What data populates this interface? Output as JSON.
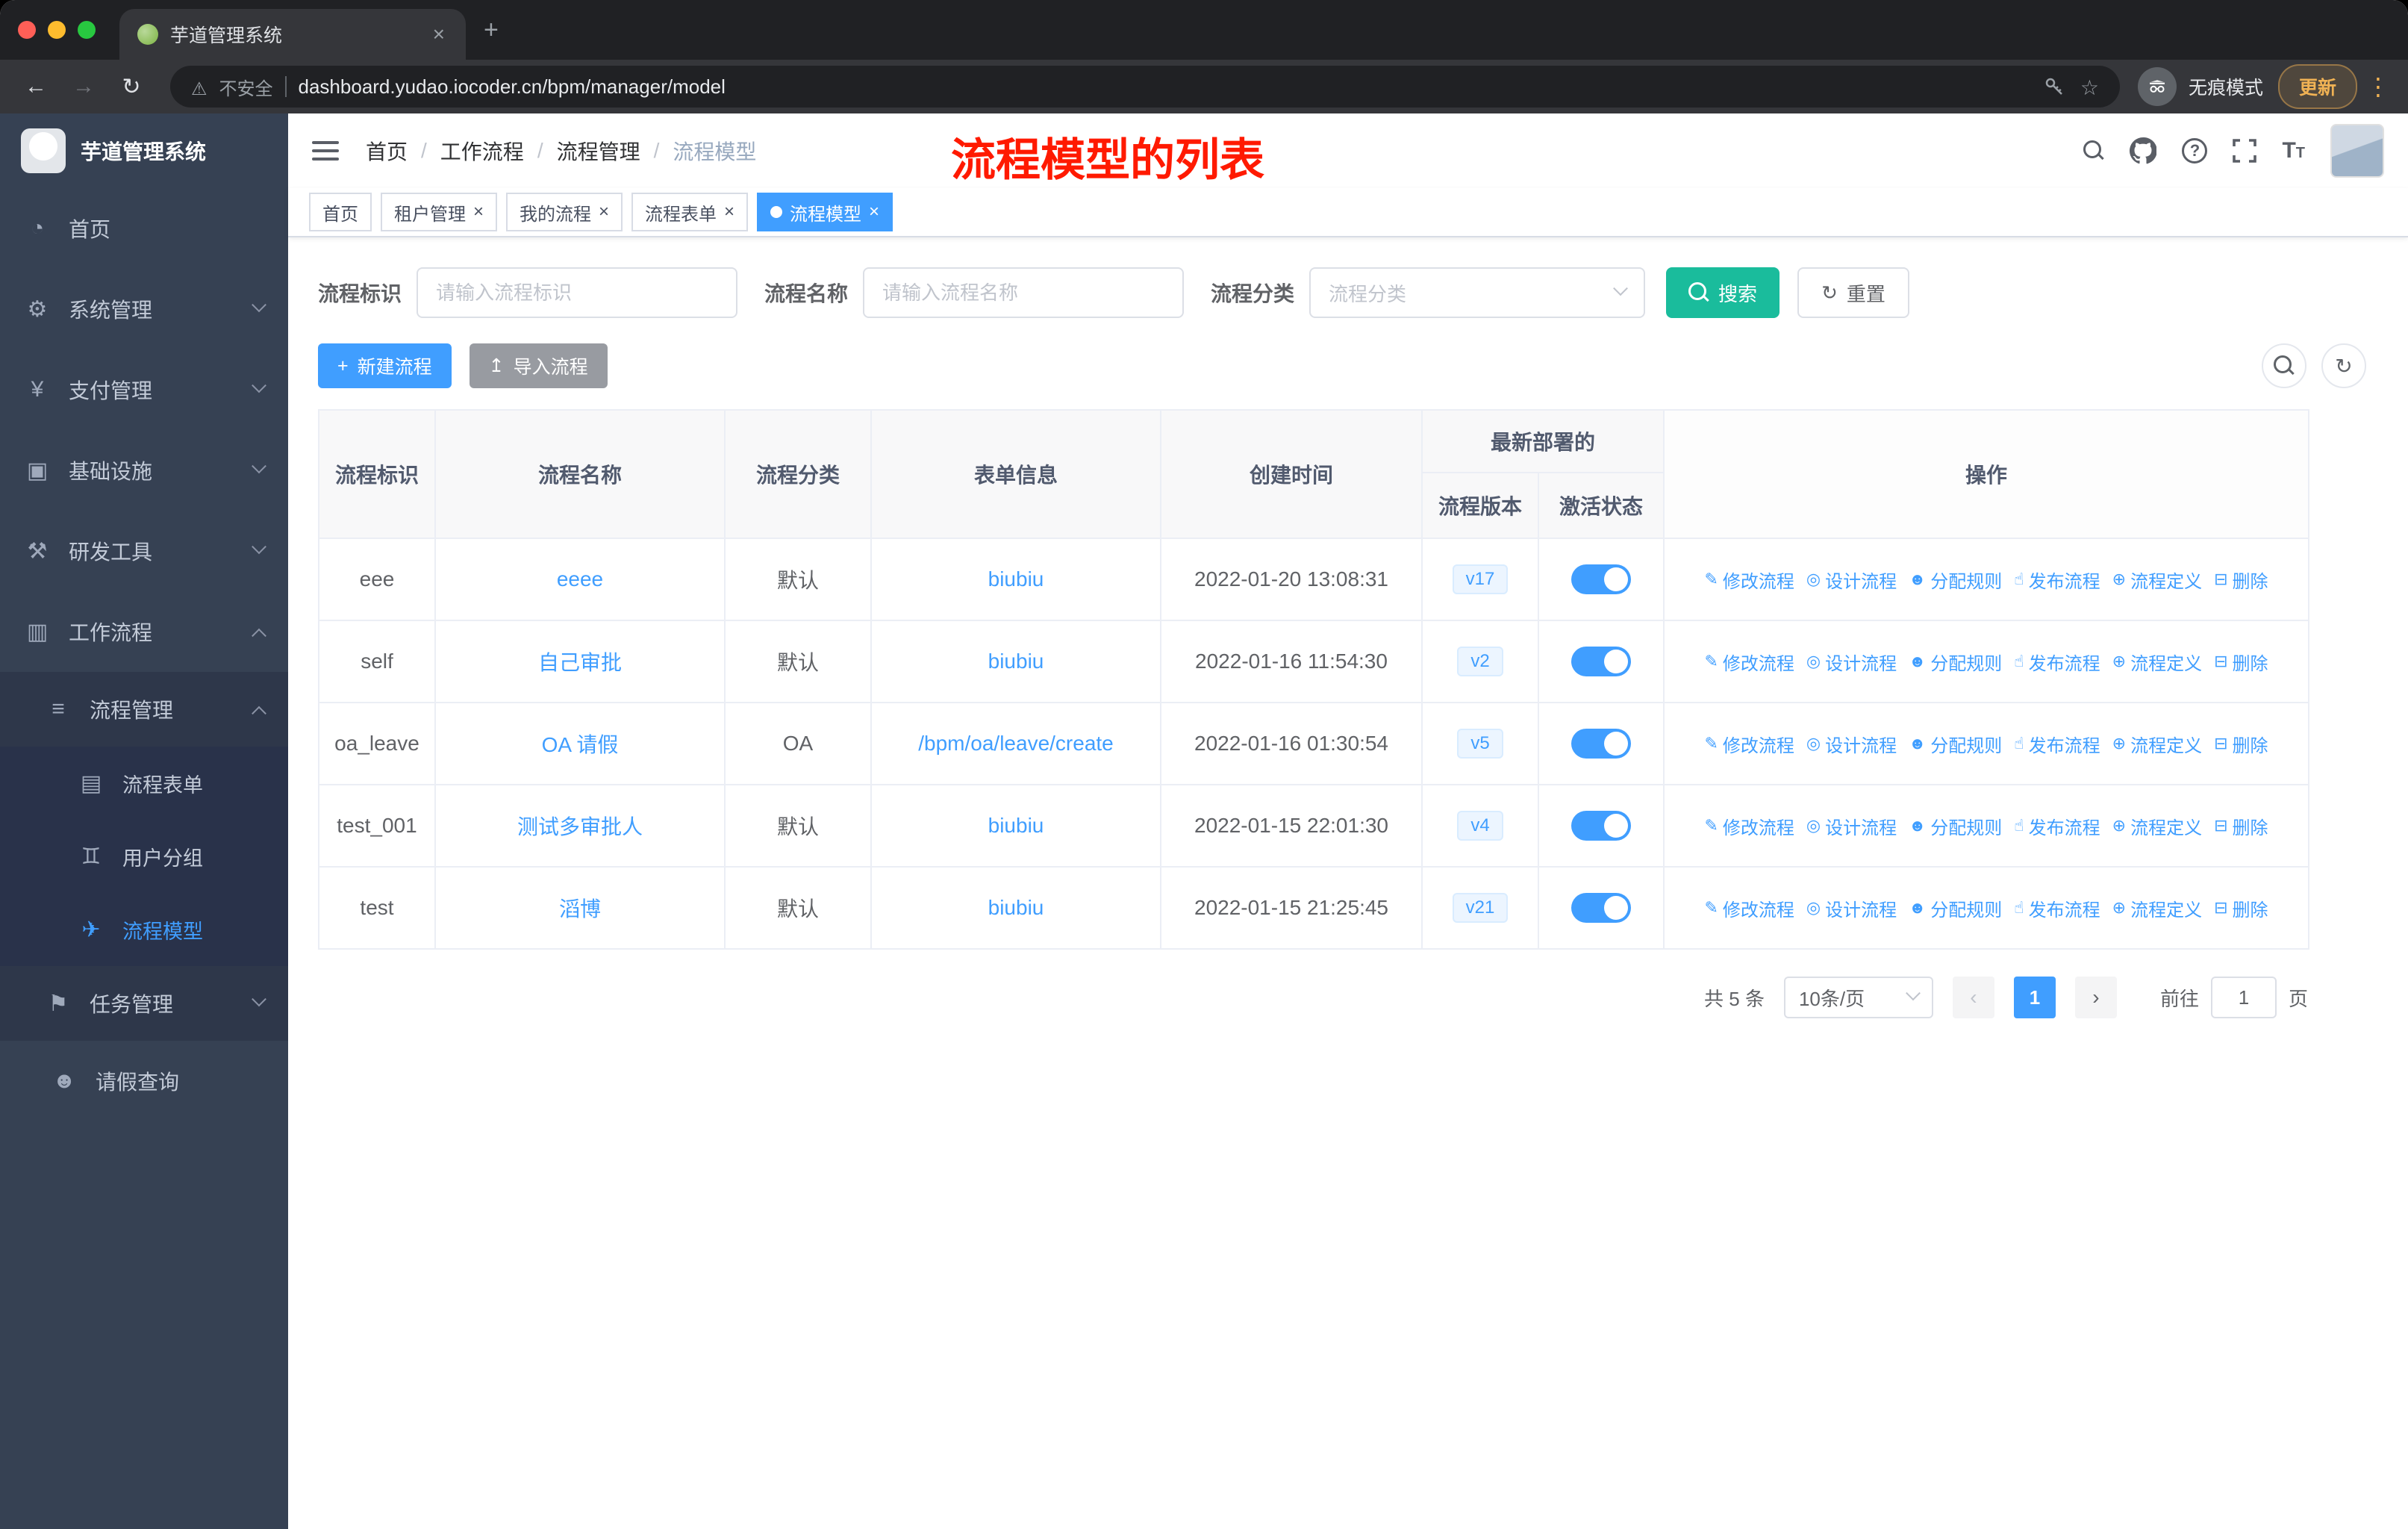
{
  "browser": {
    "tab_title": "芋道管理系统",
    "security_label": "不安全",
    "url": "dashboard.yudao.iocoder.cn/bpm/manager/model",
    "incognito_label": "无痕模式",
    "update_label": "更新"
  },
  "sidebar": {
    "logo_title": "芋道管理系统",
    "items": [
      {
        "label": "首页"
      },
      {
        "label": "系统管理"
      },
      {
        "label": "支付管理"
      },
      {
        "label": "基础设施"
      },
      {
        "label": "研发工具"
      },
      {
        "label": "工作流程"
      }
    ],
    "process_mgmt": {
      "label": "流程管理"
    },
    "process_children": [
      {
        "label": "流程表单"
      },
      {
        "label": "用户分组"
      },
      {
        "label": "流程模型"
      }
    ],
    "task_mgmt": {
      "label": "任务管理"
    },
    "leave_query": {
      "label": "请假查询"
    }
  },
  "header": {
    "breadcrumb": [
      "首页",
      "工作流程",
      "流程管理",
      "流程模型"
    ],
    "annotation": "流程模型的列表"
  },
  "tags": [
    {
      "label": "首页"
    },
    {
      "label": "租户管理"
    },
    {
      "label": "我的流程"
    },
    {
      "label": "流程表单"
    },
    {
      "label": "流程模型"
    }
  ],
  "filters": {
    "key_label": "流程标识",
    "key_placeholder": "请输入流程标识",
    "name_label": "流程名称",
    "name_placeholder": "请输入流程名称",
    "category_label": "流程分类",
    "category_placeholder": "流程分类",
    "search_label": "搜索",
    "reset_label": "重置"
  },
  "toolbar": {
    "create_label": "新建流程",
    "import_label": "导入流程"
  },
  "table": {
    "columns": {
      "key": "流程标识",
      "name": "流程名称",
      "category": "流程分类",
      "form": "表单信息",
      "created": "创建时间",
      "group": "最新部署的",
      "version": "流程版本",
      "status": "激活状态",
      "ops": "操作"
    },
    "actions": [
      "修改流程",
      "设计流程",
      "分配规则",
      "发布流程",
      "流程定义",
      "删除"
    ],
    "rows": [
      {
        "key": "eee",
        "name": "eeee",
        "category": "默认",
        "form": "biubiu",
        "created": "2022-01-20 13:08:31",
        "version": "v17",
        "active": true
      },
      {
        "key": "self",
        "name": "自己审批",
        "category": "默认",
        "form": "biubiu",
        "created": "2022-01-16 11:54:30",
        "version": "v2",
        "active": true
      },
      {
        "key": "oa_leave",
        "name": "OA 请假",
        "category": "OA",
        "form": "/bpm/oa/leave/create",
        "created": "2022-01-16 01:30:54",
        "version": "v5",
        "active": true
      },
      {
        "key": "test_001",
        "name": "测试多审批人",
        "category": "默认",
        "form": "biubiu",
        "created": "2022-01-15 22:01:30",
        "version": "v4",
        "active": true
      },
      {
        "key": "test",
        "name": "滔博",
        "category": "默认",
        "form": "biubiu",
        "created": "2022-01-15 21:25:45",
        "version": "v21",
        "active": true
      }
    ]
  },
  "pagination": {
    "total": "共 5 条",
    "page_size": "10条/页",
    "current_page": "1",
    "goto_label": "前往",
    "goto_value": "1",
    "unit_label": "页"
  },
  "colors": {
    "primary": "#409EFF",
    "search_button": "#1ABC9C",
    "annotation_red": "#FF1A00",
    "toggle_on": "#409EFF",
    "sidebar_bg": "#364153"
  }
}
